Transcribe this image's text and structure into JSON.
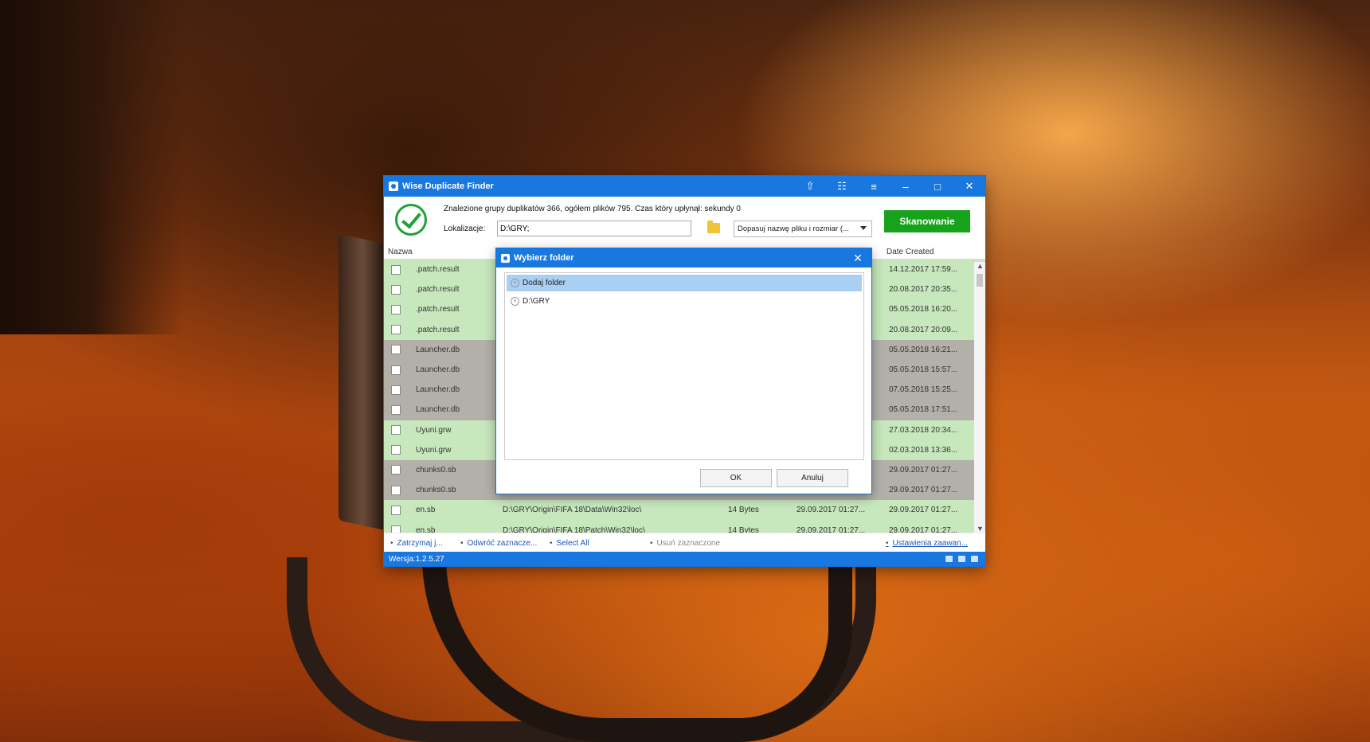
{
  "window": {
    "title": "Wise Duplicate Finder",
    "controls": [
      "⇧",
      "☷",
      "≡",
      "–",
      "□",
      "✕"
    ]
  },
  "header": {
    "status": "Znalezione grupy duplikatów 366, ogółem plików 795. Czas który upłynął: sekundy 0",
    "location_label": "Lokalizacje:",
    "location_value": "D:\\GRY;",
    "mode_select": "Dopasuj nazwę pliku i rozmiar (...",
    "scan_button": "Skanowanie"
  },
  "table": {
    "col_name": "Nazwa",
    "col_date_created": "Date Created",
    "rows": [
      {
        "name": ".patch.result",
        "path": "",
        "size": "",
        "modified": "",
        "created": "14.12.2017 17:59..."
      },
      {
        "name": ".patch.result",
        "path": "",
        "size": "",
        "modified": "",
        "created": "20.08.2017 20:35..."
      },
      {
        "name": ".patch.result",
        "path": "",
        "size": "",
        "modified": "",
        "created": "05.05.2018 16:20..."
      },
      {
        "name": ".patch.result",
        "path": "",
        "size": "",
        "modified": "",
        "created": "20.08.2017 20:09..."
      },
      {
        "name": "Launcher.db",
        "path": "",
        "size": "",
        "modified": "",
        "created": "05.05.2018 16:21..."
      },
      {
        "name": "Launcher.db",
        "path": "",
        "size": "",
        "modified": "",
        "created": "05.05.2018 15:57..."
      },
      {
        "name": "Launcher.db",
        "path": "",
        "size": "",
        "modified": "",
        "created": "07.05.2018 15:25..."
      },
      {
        "name": "Launcher.db",
        "path": "",
        "size": "",
        "modified": "",
        "created": "05.05.2018 17:51..."
      },
      {
        "name": "Uyuni.grw",
        "path": "",
        "size": "",
        "modified": "",
        "created": "27.03.2018 20:34..."
      },
      {
        "name": "Uyuni.grw",
        "path": "",
        "size": "",
        "modified": "",
        "created": "02.03.2018 13:36..."
      },
      {
        "name": "chunks0.sb",
        "path": "",
        "size": "",
        "modified": "",
        "created": "29.09.2017 01:27..."
      },
      {
        "name": "chunks0.sb",
        "path": "",
        "size": "",
        "modified": "",
        "created": "29.09.2017 01:27..."
      },
      {
        "name": "en.sb",
        "path": "D:\\GRY\\Origin\\FIFA 18\\Data\\Win32\\loc\\",
        "size": "14 Bytes",
        "modified": "29.09.2017 01:27...",
        "created": "29.09.2017 01:27..."
      },
      {
        "name": "en.sb",
        "path": "D:\\GRY\\Origin\\FIFA 18\\Patch\\Win32\\loc\\",
        "size": "14 Bytes",
        "modified": "29.09.2017 01:27...",
        "created": "29.09.2017 01:27..."
      }
    ]
  },
  "footer": {
    "stop": "Zatrzymaj j...",
    "invert": "Odwróć zaznacze...",
    "select_all": "Select All",
    "remove": "Usuń zaznaczone",
    "advanced": "Ustawienia zaawan..."
  },
  "statusbar": {
    "version": "Wersja:1.2.5.27"
  },
  "dialog": {
    "title": "Wybierz folder",
    "items": [
      {
        "label": "Dodaj folder",
        "icon": "+"
      },
      {
        "label": "D:\\GRY",
        "icon": "×"
      }
    ],
    "ok": "OK",
    "cancel": "Anuluj"
  },
  "colors": {
    "accent": "#1977e0",
    "scan_green": "#17a21c",
    "row_green": "#c7e7bd",
    "row_gray": "#b3b0aa"
  }
}
